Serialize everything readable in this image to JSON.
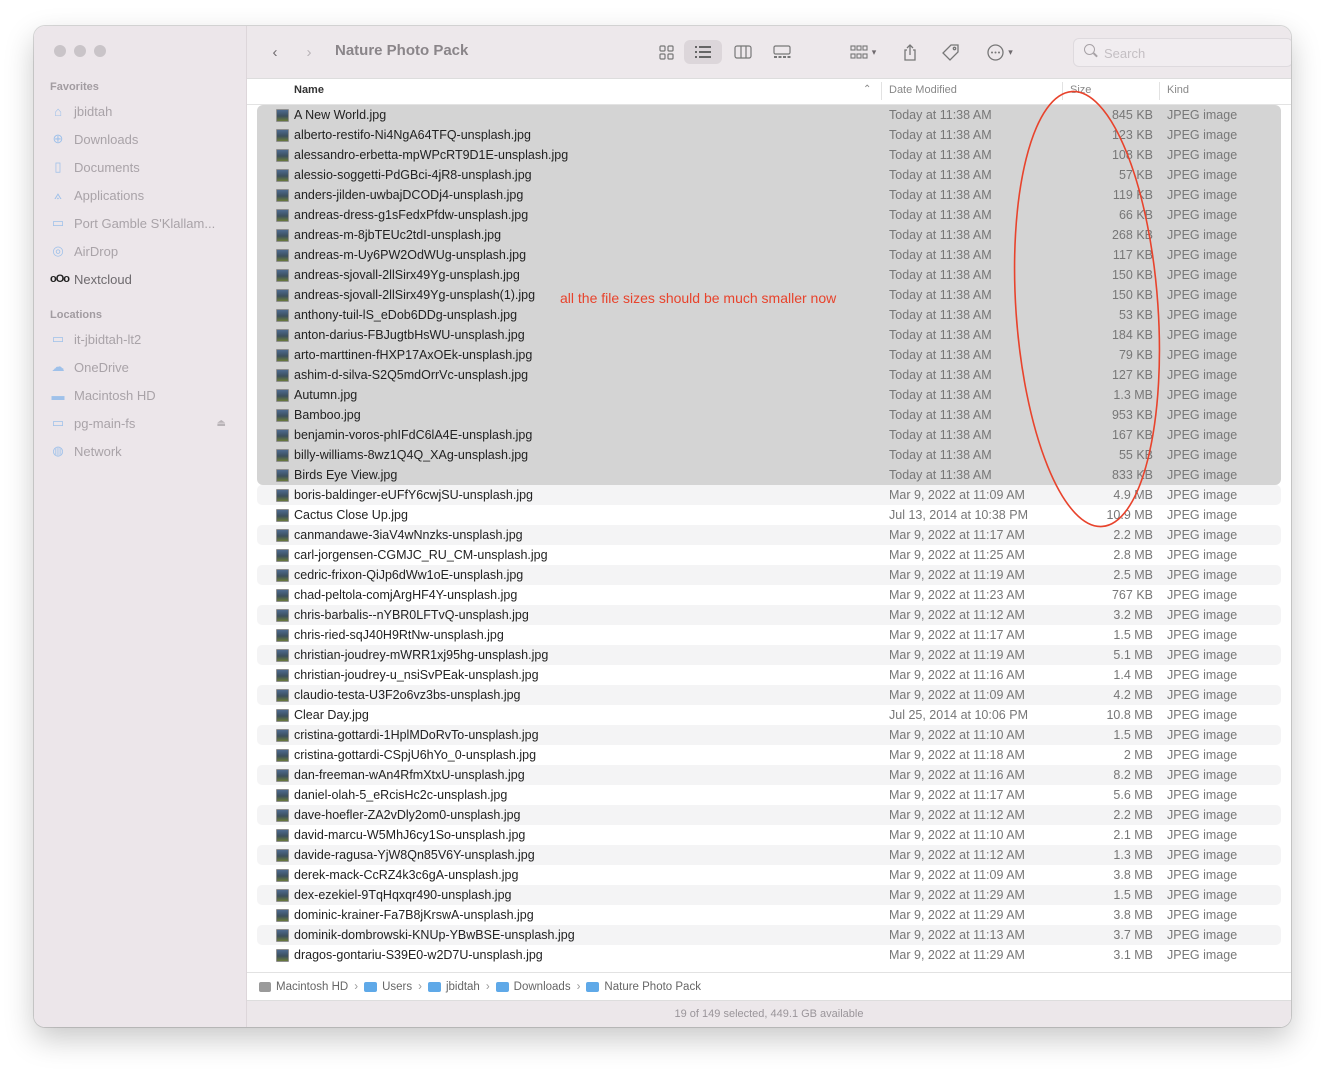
{
  "window": {
    "title": "Nature Photo Pack"
  },
  "sidebar": {
    "favorites_label": "Favorites",
    "favorites": [
      {
        "label": "jbidtah",
        "icon": "home-icon"
      },
      {
        "label": "Downloads",
        "icon": "download-icon"
      },
      {
        "label": "Documents",
        "icon": "document-icon"
      },
      {
        "label": "Applications",
        "icon": "applications-icon"
      },
      {
        "label": "Port Gamble S'Klallam...",
        "icon": "folder-icon"
      },
      {
        "label": "AirDrop",
        "icon": "airdrop-icon"
      },
      {
        "label": "Nextcloud",
        "icon": "nextcloud-icon"
      }
    ],
    "locations_label": "Locations",
    "locations": [
      {
        "label": "it-jbidtah-lt2",
        "icon": "laptop-icon"
      },
      {
        "label": "OneDrive",
        "icon": "cloud-icon"
      },
      {
        "label": "Macintosh HD",
        "icon": "disk-icon"
      },
      {
        "label": "pg-main-fs",
        "icon": "server-icon"
      },
      {
        "label": "Network",
        "icon": "network-icon"
      }
    ]
  },
  "toolbar": {
    "search_placeholder": "Search"
  },
  "columns": {
    "name": "Name",
    "date": "Date Modified",
    "size": "Size",
    "kind": "Kind"
  },
  "annotation": {
    "text": "all the file sizes should be much smaller now",
    "color": "#e8432c"
  },
  "files": [
    {
      "name": "A New World.jpg",
      "date": "Today at 11:38 AM",
      "size": "845 KB",
      "kind": "JPEG image",
      "selected": true
    },
    {
      "name": "alberto-restifo-Ni4NgA64TFQ-unsplash.jpg",
      "date": "Today at 11:38 AM",
      "size": "123 KB",
      "kind": "JPEG image",
      "selected": true
    },
    {
      "name": "alessandro-erbetta-mpWPcRT9D1E-unsplash.jpg",
      "date": "Today at 11:38 AM",
      "size": "108 KB",
      "kind": "JPEG image",
      "selected": true
    },
    {
      "name": "alessio-soggetti-PdGBci-4jR8-unsplash.jpg",
      "date": "Today at 11:38 AM",
      "size": "57 KB",
      "kind": "JPEG image",
      "selected": true
    },
    {
      "name": "anders-jilden-uwbajDCODj4-unsplash.jpg",
      "date": "Today at 11:38 AM",
      "size": "119 KB",
      "kind": "JPEG image",
      "selected": true
    },
    {
      "name": "andreas-dress-g1sFedxPfdw-unsplash.jpg",
      "date": "Today at 11:38 AM",
      "size": "66 KB",
      "kind": "JPEG image",
      "selected": true
    },
    {
      "name": "andreas-m-8jbTEUc2tdI-unsplash.jpg",
      "date": "Today at 11:38 AM",
      "size": "268 KB",
      "kind": "JPEG image",
      "selected": true
    },
    {
      "name": "andreas-m-Uy6PW2OdWUg-unsplash.jpg",
      "date": "Today at 11:38 AM",
      "size": "117 KB",
      "kind": "JPEG image",
      "selected": true
    },
    {
      "name": "andreas-sjovall-2llSirx49Yg-unsplash.jpg",
      "date": "Today at 11:38 AM",
      "size": "150 KB",
      "kind": "JPEG image",
      "selected": true
    },
    {
      "name": "andreas-sjovall-2llSirx49Yg-unsplash(1).jpg",
      "date": "Today at 11:38 AM",
      "size": "150 KB",
      "kind": "JPEG image",
      "selected": true
    },
    {
      "name": "anthony-tuil-lS_eDob6DDg-unsplash.jpg",
      "date": "Today at 11:38 AM",
      "size": "53 KB",
      "kind": "JPEG image",
      "selected": true
    },
    {
      "name": "anton-darius-FBJugtbHsWU-unsplash.jpg",
      "date": "Today at 11:38 AM",
      "size": "184 KB",
      "kind": "JPEG image",
      "selected": true
    },
    {
      "name": "arto-marttinen-fHXP17AxOEk-unsplash.jpg",
      "date": "Today at 11:38 AM",
      "size": "79 KB",
      "kind": "JPEG image",
      "selected": true
    },
    {
      "name": "ashim-d-silva-S2Q5mdOrrVc-unsplash.jpg",
      "date": "Today at 11:38 AM",
      "size": "127 KB",
      "kind": "JPEG image",
      "selected": true
    },
    {
      "name": "Autumn.jpg",
      "date": "Today at 11:38 AM",
      "size": "1.3 MB",
      "kind": "JPEG image",
      "selected": true
    },
    {
      "name": "Bamboo.jpg",
      "date": "Today at 11:38 AM",
      "size": "953 KB",
      "kind": "JPEG image",
      "selected": true
    },
    {
      "name": "benjamin-voros-phIFdC6lA4E-unsplash.jpg",
      "date": "Today at 11:38 AM",
      "size": "167 KB",
      "kind": "JPEG image",
      "selected": true
    },
    {
      "name": "billy-williams-8wz1Q4Q_XAg-unsplash.jpg",
      "date": "Today at 11:38 AM",
      "size": "55 KB",
      "kind": "JPEG image",
      "selected": true
    },
    {
      "name": "Birds Eye View.jpg",
      "date": "Today at 11:38 AM",
      "size": "833 KB",
      "kind": "JPEG image",
      "selected": true
    },
    {
      "name": "boris-baldinger-eUFfY6cwjSU-unsplash.jpg",
      "date": "Mar 9, 2022 at 11:09 AM",
      "size": "4.9 MB",
      "kind": "JPEG image",
      "selected": false
    },
    {
      "name": "Cactus Close Up.jpg",
      "date": "Jul 13, 2014 at 10:38 PM",
      "size": "10.9 MB",
      "kind": "JPEG image",
      "selected": false
    },
    {
      "name": "canmandawe-3iaV4wNnzks-unsplash.jpg",
      "date": "Mar 9, 2022 at 11:17 AM",
      "size": "2.2 MB",
      "kind": "JPEG image",
      "selected": false
    },
    {
      "name": "carl-jorgensen-CGMJC_RU_CM-unsplash.jpg",
      "date": "Mar 9, 2022 at 11:25 AM",
      "size": "2.8 MB",
      "kind": "JPEG image",
      "selected": false
    },
    {
      "name": "cedric-frixon-QiJp6dWw1oE-unsplash.jpg",
      "date": "Mar 9, 2022 at 11:19 AM",
      "size": "2.5 MB",
      "kind": "JPEG image",
      "selected": false
    },
    {
      "name": "chad-peltola-comjArgHF4Y-unsplash.jpg",
      "date": "Mar 9, 2022 at 11:23 AM",
      "size": "767 KB",
      "kind": "JPEG image",
      "selected": false
    },
    {
      "name": "chris-barbalis--nYBR0LFTvQ-unsplash.jpg",
      "date": "Mar 9, 2022 at 11:12 AM",
      "size": "3.2 MB",
      "kind": "JPEG image",
      "selected": false
    },
    {
      "name": "chris-ried-sqJ40H9RtNw-unsplash.jpg",
      "date": "Mar 9, 2022 at 11:17 AM",
      "size": "1.5 MB",
      "kind": "JPEG image",
      "selected": false
    },
    {
      "name": "christian-joudrey-mWRR1xj95hg-unsplash.jpg",
      "date": "Mar 9, 2022 at 11:19 AM",
      "size": "5.1 MB",
      "kind": "JPEG image",
      "selected": false
    },
    {
      "name": "christian-joudrey-u_nsiSvPEak-unsplash.jpg",
      "date": "Mar 9, 2022 at 11:16 AM",
      "size": "1.4 MB",
      "kind": "JPEG image",
      "selected": false
    },
    {
      "name": "claudio-testa-U3F2o6vz3bs-unsplash.jpg",
      "date": "Mar 9, 2022 at 11:09 AM",
      "size": "4.2 MB",
      "kind": "JPEG image",
      "selected": false
    },
    {
      "name": "Clear Day.jpg",
      "date": "Jul 25, 2014 at 10:06 PM",
      "size": "10.8 MB",
      "kind": "JPEG image",
      "selected": false
    },
    {
      "name": "cristina-gottardi-1HplMDoRvTo-unsplash.jpg",
      "date": "Mar 9, 2022 at 11:10 AM",
      "size": "1.5 MB",
      "kind": "JPEG image",
      "selected": false
    },
    {
      "name": "cristina-gottardi-CSpjU6hYo_0-unsplash.jpg",
      "date": "Mar 9, 2022 at 11:18 AM",
      "size": "2 MB",
      "kind": "JPEG image",
      "selected": false
    },
    {
      "name": "dan-freeman-wAn4RfmXtxU-unsplash.jpg",
      "date": "Mar 9, 2022 at 11:16 AM",
      "size": "8.2 MB",
      "kind": "JPEG image",
      "selected": false
    },
    {
      "name": "daniel-olah-5_eRcisHc2c-unsplash.jpg",
      "date": "Mar 9, 2022 at 11:17 AM",
      "size": "5.6 MB",
      "kind": "JPEG image",
      "selected": false
    },
    {
      "name": "dave-hoefler-ZA2vDly2om0-unsplash.jpg",
      "date": "Mar 9, 2022 at 11:12 AM",
      "size": "2.2 MB",
      "kind": "JPEG image",
      "selected": false
    },
    {
      "name": "david-marcu-W5MhJ6cy1So-unsplash.jpg",
      "date": "Mar 9, 2022 at 11:10 AM",
      "size": "2.1 MB",
      "kind": "JPEG image",
      "selected": false
    },
    {
      "name": "davide-ragusa-YjW8Qn85V6Y-unsplash.jpg",
      "date": "Mar 9, 2022 at 11:12 AM",
      "size": "1.3 MB",
      "kind": "JPEG image",
      "selected": false
    },
    {
      "name": "derek-mack-CcRZ4k3c6gA-unsplash.jpg",
      "date": "Mar 9, 2022 at 11:09 AM",
      "size": "3.8 MB",
      "kind": "JPEG image",
      "selected": false
    },
    {
      "name": "dex-ezekiel-9TqHqxqr490-unsplash.jpg",
      "date": "Mar 9, 2022 at 11:29 AM",
      "size": "1.5 MB",
      "kind": "JPEG image",
      "selected": false
    },
    {
      "name": "dominic-krainer-Fa7B8jKrswA-unsplash.jpg",
      "date": "Mar 9, 2022 at 11:29 AM",
      "size": "3.8 MB",
      "kind": "JPEG image",
      "selected": false
    },
    {
      "name": "dominik-dombrowski-KNUp-YBwBSE-unsplash.jpg",
      "date": "Mar 9, 2022 at 11:13 AM",
      "size": "3.7 MB",
      "kind": "JPEG image",
      "selected": false
    },
    {
      "name": "dragos-gontariu-S39E0-w2D7U-unsplash.jpg",
      "date": "Mar 9, 2022 at 11:29 AM",
      "size": "3.1 MB",
      "kind": "JPEG image",
      "selected": false
    }
  ],
  "pathbar": [
    {
      "label": "Macintosh HD",
      "icon": "disk-icon"
    },
    {
      "label": "Users",
      "icon": "folder-icon"
    },
    {
      "label": "jbidtah",
      "icon": "folder-icon"
    },
    {
      "label": "Downloads",
      "icon": "folder-icon"
    },
    {
      "label": "Nature Photo Pack",
      "icon": "folder-icon"
    }
  ],
  "status": {
    "text": "19 of 149 selected, 449.1 GB available"
  }
}
